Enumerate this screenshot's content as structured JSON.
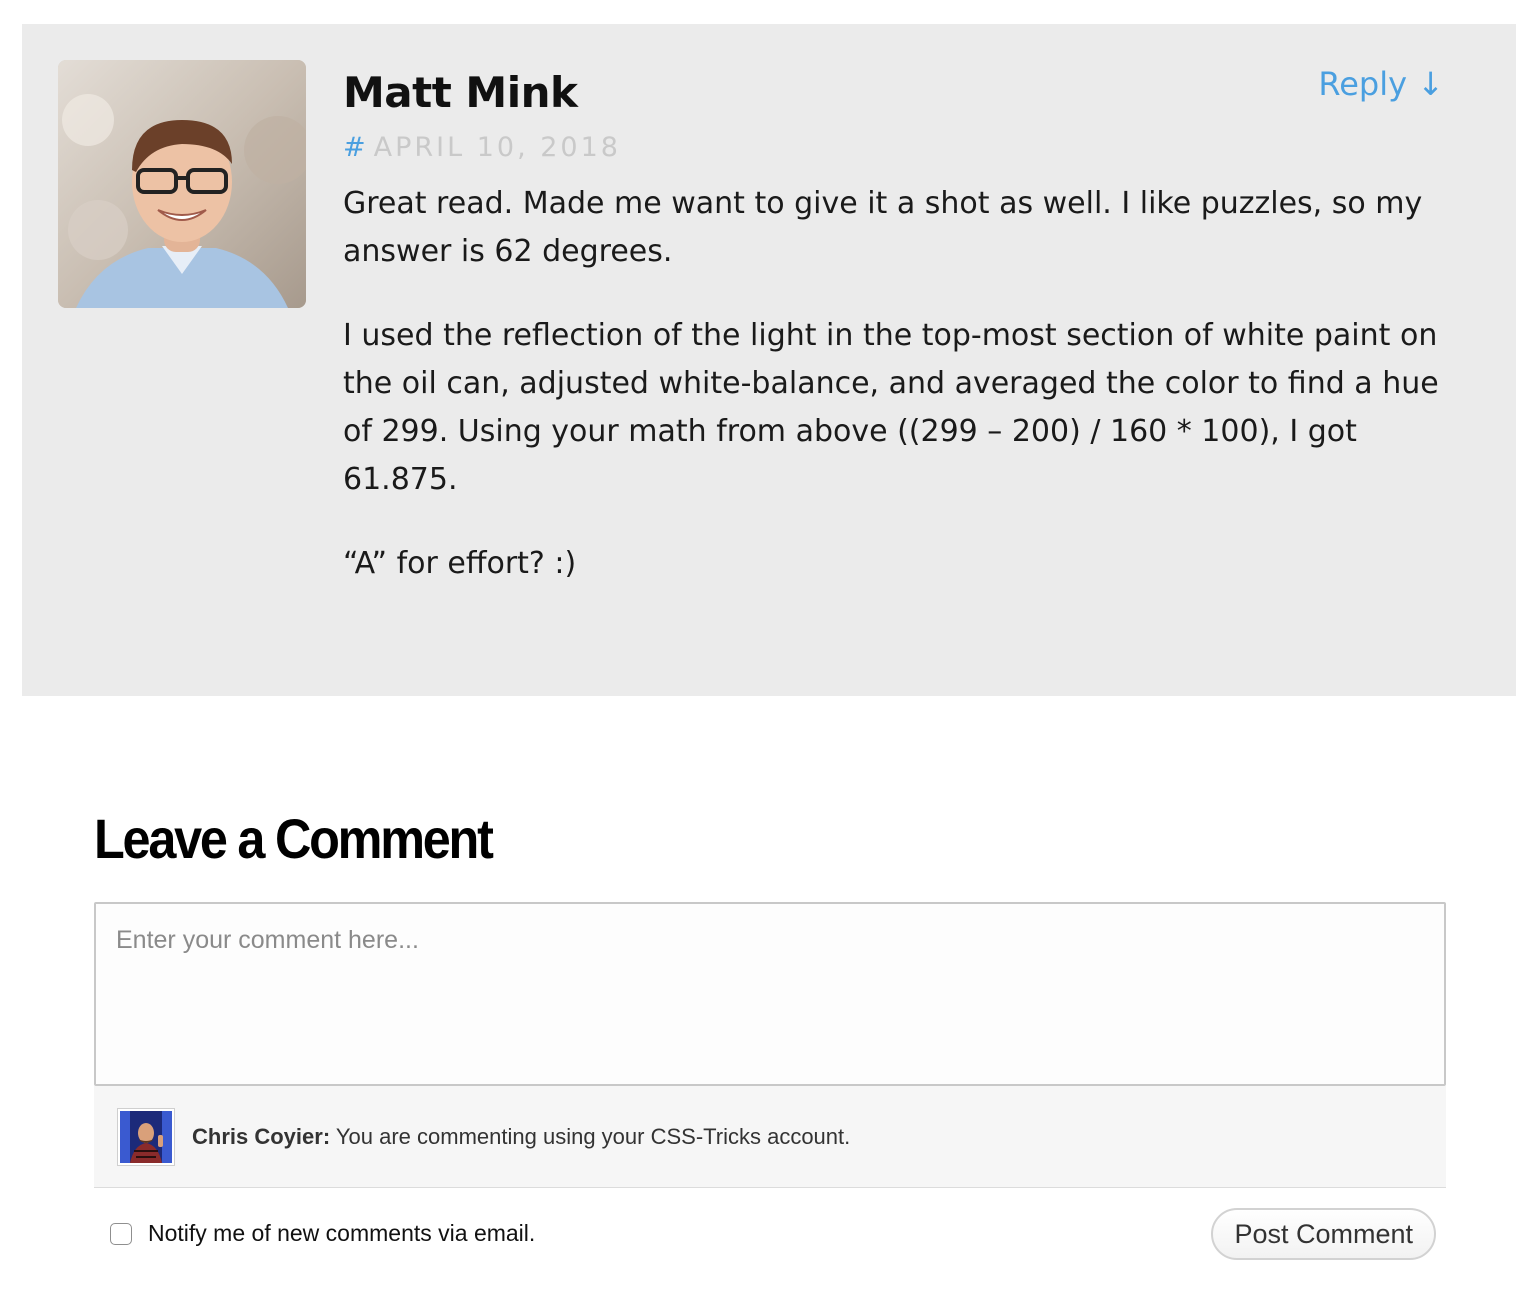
{
  "comment": {
    "author": "Matt Mink",
    "reply_label": "Reply ↓",
    "permalink_symbol": "#",
    "date": "APRIL 10, 2018",
    "paragraphs": [
      "Great read. Made me want to give it a shot as well. I like puzzles, so my answer is 62 degrees.",
      "I used the reflection of the light in the top-most section of white paint on the oil can, adjusted white-balance, and averaged the color to find a hue of 299. Using your math from above ((299 – 200) / 160 * 100), I got 61.875.",
      "“A” for effort? :)"
    ]
  },
  "form": {
    "heading": "Leave a Comment",
    "textarea_placeholder": "Enter your comment here...",
    "identity_name": "Chris Coyier:",
    "identity_text": "You are commenting using your CSS-Tricks account.",
    "notify_label": "Notify me of new comments via email.",
    "submit_label": "Post Comment"
  },
  "colors": {
    "accent": "#4a9fe0",
    "card_background": "#ebebeb"
  }
}
